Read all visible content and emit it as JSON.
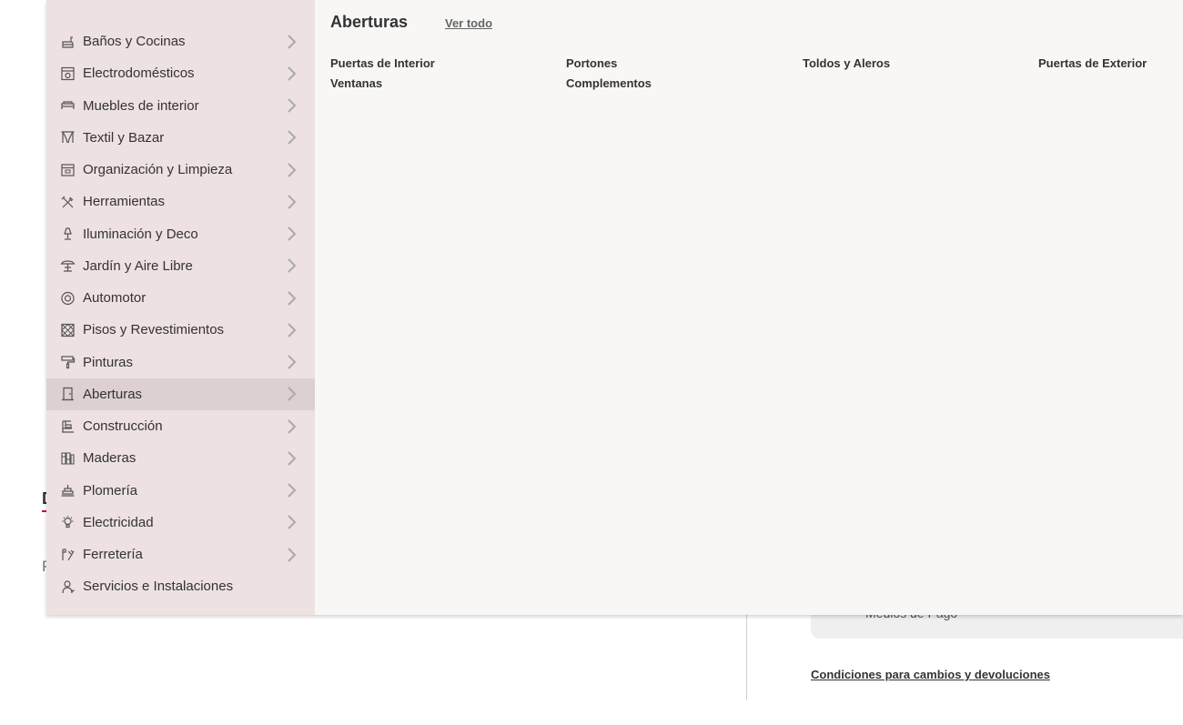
{
  "background": {
    "heading_fragment": "D",
    "text_fragment": "P",
    "card_text": "Medios de Pago",
    "link_text": "Condiciones para cambios y devoluciones"
  },
  "menu": {
    "categories": [
      {
        "label": "Baños y Cocinas",
        "icon": "faucet-icon",
        "has_children": true
      },
      {
        "label": "Electrodomésticos",
        "icon": "appliance-icon",
        "has_children": true
      },
      {
        "label": "Muebles de interior",
        "icon": "bed-icon",
        "has_children": true
      },
      {
        "label": "Textil y Bazar",
        "icon": "curtain-icon",
        "has_children": true
      },
      {
        "label": "Organización y Limpieza",
        "icon": "storage-box-icon",
        "has_children": true
      },
      {
        "label": "Herramientas",
        "icon": "tools-icon",
        "has_children": true
      },
      {
        "label": "Iluminación y Deco",
        "icon": "lamp-icon",
        "has_children": true
      },
      {
        "label": "Jardín y Aire Libre",
        "icon": "umbrella-table-icon",
        "has_children": true
      },
      {
        "label": "Automotor",
        "icon": "tire-icon",
        "has_children": true
      },
      {
        "label": "Pisos y Revestimientos",
        "icon": "tiles-icon",
        "has_children": true
      },
      {
        "label": "Pinturas",
        "icon": "paint-roller-icon",
        "has_children": true
      },
      {
        "label": "Aberturas",
        "icon": "door-icon",
        "has_children": true,
        "active": true
      },
      {
        "label": "Construcción",
        "icon": "construction-icon",
        "has_children": true
      },
      {
        "label": "Maderas",
        "icon": "wood-planks-icon",
        "has_children": true
      },
      {
        "label": "Plomería",
        "icon": "plumbing-icon",
        "has_children": true
      },
      {
        "label": "Electricidad",
        "icon": "lightbulb-icon",
        "has_children": true
      },
      {
        "label": "Ferretería",
        "icon": "hardware-icon",
        "has_children": true
      },
      {
        "label": "Servicios e Instalaciones",
        "icon": "service-worker-icon",
        "has_children": false
      }
    ],
    "panel": {
      "title": "Aberturas",
      "view_all": "Ver todo",
      "subcategories": [
        "Puertas de Interior",
        "Portones",
        "Toldos y Aleros",
        "Puertas de Exterior",
        "Ventanas",
        "Complementos"
      ]
    }
  },
  "colors": {
    "sidebar_bg": "#ede1e1",
    "active_item_bg": "#dcd0d0",
    "panel_bg": "#f8f7f6",
    "accent": "#d0021b"
  }
}
